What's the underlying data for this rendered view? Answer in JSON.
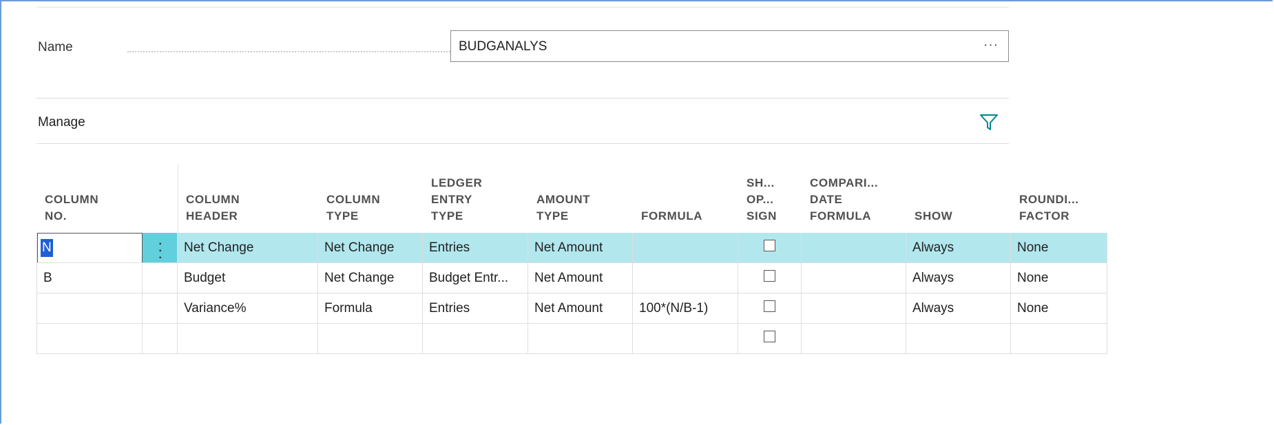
{
  "form": {
    "name_label": "Name",
    "name_value": "BUDGANALYS",
    "name_lookup": "···"
  },
  "section": {
    "manage_label": "Manage",
    "filter_icon": "filter-icon"
  },
  "table": {
    "headers": [
      "COLUMN\nNO.",
      "COLUMN\nHEADER",
      "COLUMN\nTYPE",
      "LEDGER\nENTRY\nTYPE",
      "AMOUNT\nTYPE",
      "FORMULA",
      "SH...\nOP...\nSIGN",
      "COMPARI...\nDATE\nFORMULA",
      "SHOW",
      "ROUNDI...\nFACTOR"
    ],
    "rows": [
      {
        "no": "N",
        "header": "Net Change",
        "type": "Net Change",
        "ledger": "Entries",
        "amount": "Net Amount",
        "formula": "",
        "show_opp": false,
        "comp_date": "",
        "show": "Always",
        "rounding": "None"
      },
      {
        "no": "B",
        "header": "Budget",
        "type": "Net Change",
        "ledger": "Budget Entr...",
        "amount": "Net Amount",
        "formula": "",
        "show_opp": false,
        "comp_date": "",
        "show": "Always",
        "rounding": "None"
      },
      {
        "no": "",
        "header": "Variance%",
        "type": "Formula",
        "ledger": "Entries",
        "amount": "Net Amount",
        "formula": "100*(N/B-1)",
        "show_opp": false,
        "comp_date": "",
        "show": "Always",
        "rounding": "None"
      },
      {
        "no": "",
        "header": "",
        "type": "",
        "ledger": "",
        "amount": "",
        "formula": "",
        "show_opp": false,
        "comp_date": "",
        "show": "",
        "rounding": ""
      }
    ]
  },
  "colors": {
    "selected_row": "#b2e7ee",
    "kebab_bg": "#62cfdd",
    "accent": "#008489"
  }
}
